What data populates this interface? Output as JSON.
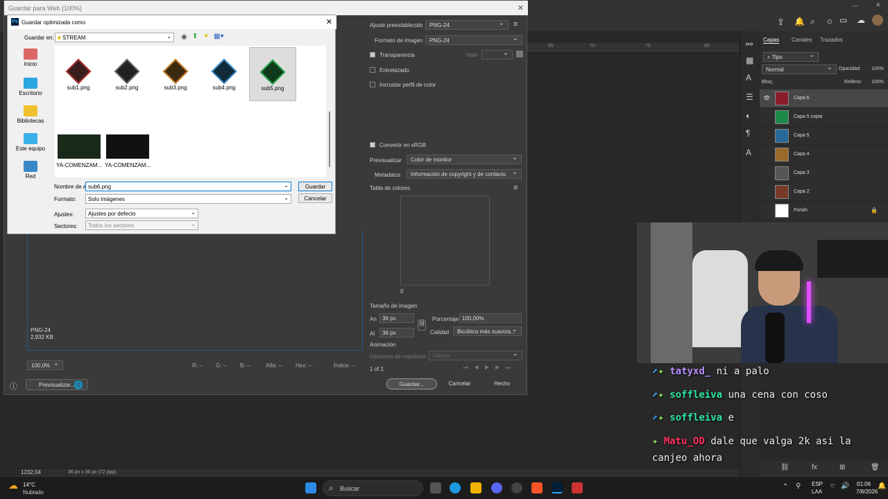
{
  "sfw": {
    "title": "Guardar para Web (100%)",
    "preset_label": "Ajuste preestablecido",
    "preset_value": "PNG-24",
    "format_label": "Formato de imagen",
    "format_value": "PNG-24",
    "transparency_label": "Transparencia",
    "halo_label": "Halo",
    "interlaced_label": "Entrelazado",
    "embed_label": "Incrustar perfil de color",
    "srgb_label": "Convertir en sRGB",
    "preview_label": "Previsualizar",
    "preview_value": "Color de monitor",
    "meta_label": "Metadatos",
    "meta_value": "Información de copyright y de contacto",
    "colortable_label": "Tabla de colores",
    "colortable_count": "0",
    "imgsize_label": "Tamaño de imagen",
    "w_label": "An",
    "w_value": "36 px",
    "h_label": "Al",
    "h_value": "36 px",
    "pct_label": "Porcentaje",
    "pct_value": "100,00%",
    "quality_label": "Calidad",
    "quality_value": "Bicúbica más suaviza...",
    "anim_label": "Animación",
    "repeat_label": "Opciones de repetición",
    "repeat_value": "Infinito",
    "frame_counter": "1 of 1",
    "info_format": "PNG-24",
    "info_size": "2,932 KB",
    "zoom": "100,0%",
    "r": "R: --",
    "g": "G: --",
    "b": "B: --",
    "alpha": "Alfa: --",
    "hex": "Hex: --",
    "index": "Índice: --",
    "preview_btn": "Previsualizar...",
    "save_btn": "Guardar...",
    "cancel_btn": "Cancelar",
    "done_btn": "Hecho"
  },
  "filedialog": {
    "title": "Guardar optimizada como",
    "save_in_label": "Guardar en:",
    "folder": "STREAM",
    "places": [
      "Inicio",
      "Escritorio",
      "Bibliotecas",
      "Este equipo",
      "Red"
    ],
    "files": [
      "sub1.png",
      "sub2.png",
      "sub3.png",
      "sub4.png",
      "sub5.png"
    ],
    "videos": [
      "YA-COMENZAM...",
      "YA-COMENZAM..."
    ],
    "filename_label": "Nombre de ar",
    "filename_value": "sub6.png",
    "format_label": "Formato:",
    "format_value": "Solo imágenes",
    "settings_label": "Ajustes:",
    "settings_value": "Ajustes por defecto",
    "slices_label": "Sectores:",
    "slices_value": "Todos los sectores",
    "save_btn": "Guardar",
    "cancel_btn": "Cancelar"
  },
  "layers": {
    "tabs": [
      "Capas",
      "Canales",
      "Trazados"
    ],
    "kind": "Tipo",
    "blend": "Normal",
    "opacity_label": "Opacidad:",
    "opacity_value": "100%",
    "lock_label": "Bloq.:",
    "fill_label": "Relleno:",
    "fill_value": "100%",
    "items": [
      "Capa 6",
      "Capa 5 copia",
      "Capa 5",
      "Capa 4",
      "Capa 3",
      "Capa 2",
      "Fondo"
    ],
    "status": "36 px x 36 px (72 ppp)",
    "zoom": "1232,04"
  },
  "ruler": [
    "55",
    "60",
    "65",
    "70",
    "75",
    "80"
  ],
  "chat": [
    {
      "user": "tatyxd_",
      "msg": "ni a palo",
      "color": "#b88cff"
    },
    {
      "user": "soffleiva",
      "msg": "una cena con coso",
      "color": "#2ee6a0"
    },
    {
      "user": "soffleiva",
      "msg": "e",
      "color": "#2ee6a0"
    },
    {
      "user": "Matu_OD",
      "msg": "dale que valga 2k asi la",
      "color": "#ff2f5f"
    },
    {
      "user": "",
      "msg": "canjeo ahora",
      "color": "#eeeeee"
    }
  ],
  "taskbar": {
    "weather_temp": "14°C",
    "weather_desc": "Nublado",
    "search": "Buscar",
    "lang1": "ESP",
    "lang2": "LAA",
    "time": "01:06",
    "date": "7/8/2026"
  }
}
